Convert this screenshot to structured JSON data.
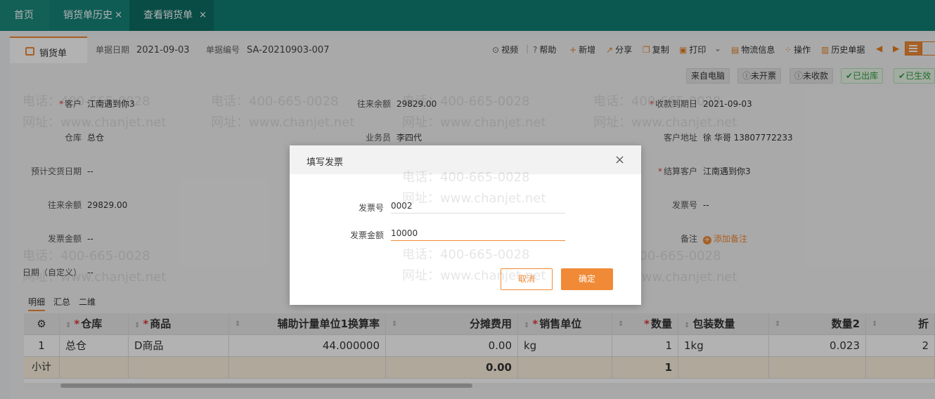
{
  "tabs": [
    {
      "label": "首页"
    },
    {
      "label": "销货单历史",
      "close": "×"
    },
    {
      "label": "查看销货单",
      "close": "×"
    }
  ],
  "doc": {
    "tab_label": "销货单",
    "date_label": "单据日期",
    "date": "2021-09-03",
    "no_label": "单据编号",
    "no": "SA-20210903-007"
  },
  "toolbar": {
    "video": "视频",
    "sep": "|",
    "help": "帮助",
    "new": "新增",
    "share": "分享",
    "copy": "复制",
    "print": "打印",
    "logistics": "物流信息",
    "ops": "操作",
    "history": "历史单据"
  },
  "badges": [
    "来自电脑",
    "未开票",
    "未收款",
    "已出库",
    "已生效"
  ],
  "form": {
    "customer_label": "客户",
    "customer": "江南遇到你3",
    "balance_label": "往来余额",
    "balance": "29829.00",
    "due_label": "收款到期日",
    "due": "2021-09-03",
    "warehouse_label": "仓库",
    "warehouse": "总仓",
    "salesman_label": "业务员",
    "salesman": "李四代",
    "address_label": "客户地址",
    "address": "徐 华哥 13807772233",
    "delivery_label": "预计交货日期",
    "delivery": "--",
    "settle_label": "结算客户",
    "settle": "江南遇到你3",
    "balance2_label": "往来余额",
    "balance2": "29829.00",
    "invoice_no_label": "发票号",
    "invoice_no": "--",
    "invoice_amt_label": "发票金额",
    "invoice_amt": "--",
    "note_label": "备注",
    "note_add": "添加备注",
    "custom_date_label": "日期（自定义）",
    "custom_date": "--"
  },
  "subtabs": [
    "明细",
    "汇总",
    "二维"
  ],
  "grid": {
    "headers": [
      "仓库",
      "商品",
      "辅助计量单位1换算率",
      "分摊费用",
      "销售单位",
      "数量",
      "包装数量",
      "数量2",
      "折"
    ],
    "rows": [
      {
        "idx": "1",
        "warehouse": "总仓",
        "product": "D商品",
        "rate": "44.000000",
        "fee": "0.00",
        "unit": "kg",
        "qty": "1",
        "pack": "1kg",
        "qty2": "0.023",
        "more": "2"
      }
    ],
    "subtotal": {
      "label": "小计",
      "fee": "0.00",
      "qty": "1"
    }
  },
  "watermark": {
    "phone": "电话：400-665-0028",
    "site": "网址：www.chanjet.net"
  },
  "modal": {
    "title": "填写发票",
    "close": "×",
    "invoice_no_label": "发票号",
    "invoice_no": "0002",
    "invoice_amt_label": "发票金额",
    "invoice_amt": "10000",
    "cancel": "取消",
    "ok": "确定"
  }
}
